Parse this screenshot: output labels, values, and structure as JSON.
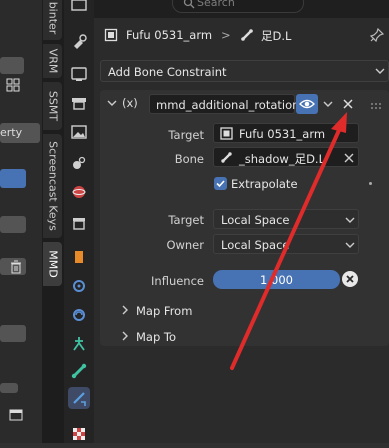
{
  "left_panel": {
    "text_partial": "erty",
    "icon_delete": "trash-icon"
  },
  "vertical_tabs": [
    {
      "label": "binter"
    },
    {
      "label": "VRM"
    },
    {
      "label": "SSMT"
    },
    {
      "label": "Screencast Keys"
    },
    {
      "label": "MMD"
    }
  ],
  "search": {
    "placeholder": "Search"
  },
  "breadcrumb": {
    "armature": "Fufu 0531_arm",
    "separator": ">",
    "bone": "足D.L"
  },
  "add_constraint": {
    "label": "Add Bone Constraint"
  },
  "constraint": {
    "type_symbol": "(x)",
    "name": "mmd_additional_rotation",
    "target_label": "Target",
    "target_value": "Fufu 0531_arm",
    "bone_label": "Bone",
    "bone_value": "_shadow_足D.L",
    "extrapolate_label": "Extrapolate",
    "extrapolate_checked": true,
    "target_space_label": "Target",
    "target_space_value": "Local Space",
    "owner_space_label": "Owner",
    "owner_space_value": "Local Space",
    "influence_label": "Influence",
    "influence_value": "1.000",
    "map_from_label": "Map From",
    "map_to_label": "Map To"
  },
  "colors": {
    "accent_blue": "#4772b3",
    "annotation_red": "#e02b2b"
  }
}
